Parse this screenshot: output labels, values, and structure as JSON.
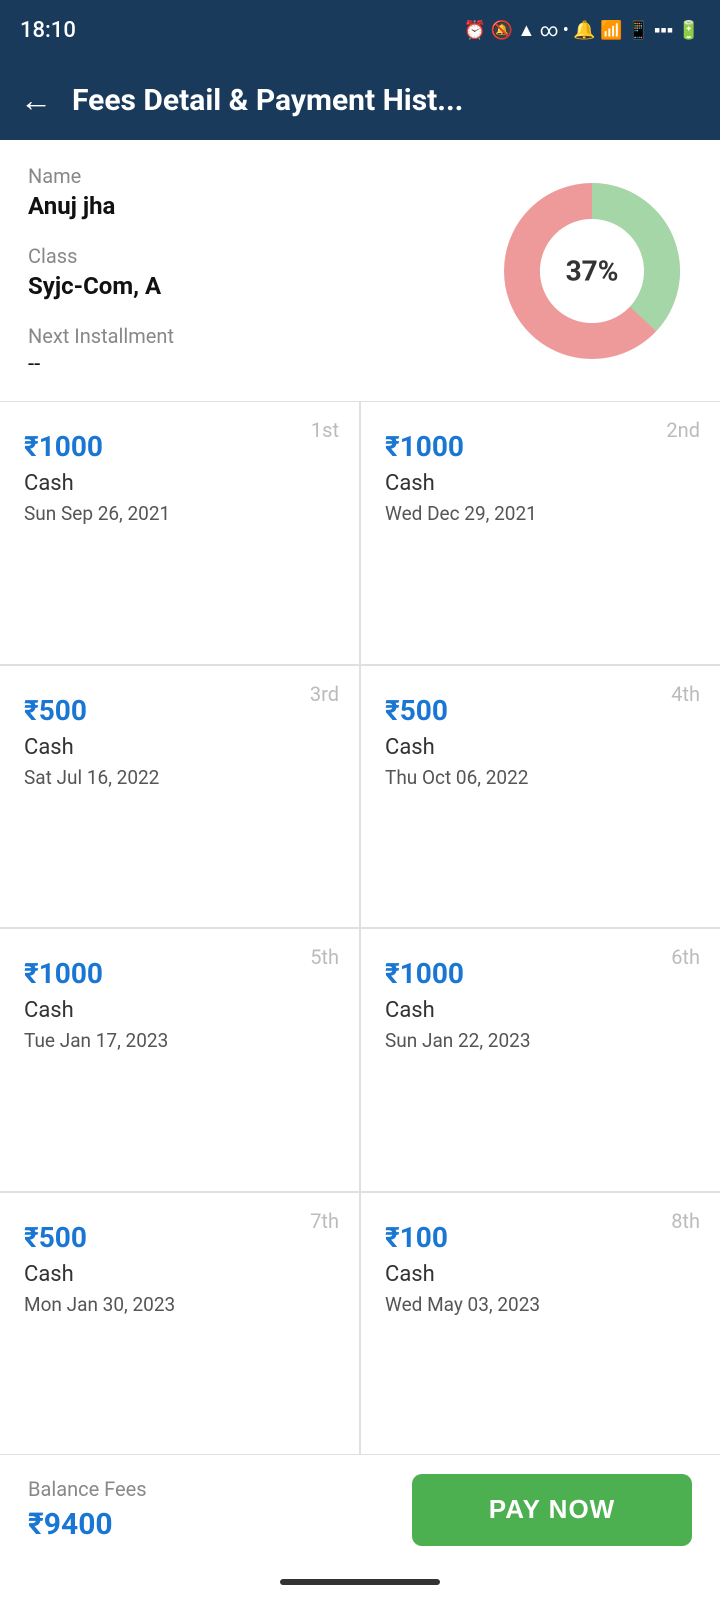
{
  "statusBar": {
    "time": "18:10",
    "icons": "⏰ 🔕 ▲ 📶 🔋"
  },
  "header": {
    "title": "Fees Detail & Payment Hist...",
    "backLabel": "←"
  },
  "profile": {
    "nameLabel": "Name",
    "nameValue": "Anuj jha",
    "classLabel": "Class",
    "classValue": "Syjc-Com, A",
    "installmentLabel": "Next Installment",
    "installmentValue": "--"
  },
  "chart": {
    "percentage": "37%",
    "paidColor": "#a5d6a7",
    "unpaidColor": "#ef9a9a"
  },
  "payments": [
    {
      "installment": "1st",
      "amount": "₹1000",
      "method": "Cash",
      "date": "Sun Sep 26, 2021"
    },
    {
      "installment": "2nd",
      "amount": "₹1000",
      "method": "Cash",
      "date": "Wed Dec 29, 2021"
    },
    {
      "installment": "3rd",
      "amount": "₹500",
      "method": "Cash",
      "date": "Sat Jul 16, 2022"
    },
    {
      "installment": "4th",
      "amount": "₹500",
      "method": "Cash",
      "date": "Thu Oct 06, 2022"
    },
    {
      "installment": "5th",
      "amount": "₹1000",
      "method": "Cash",
      "date": "Tue Jan 17, 2023"
    },
    {
      "installment": "6th",
      "amount": "₹1000",
      "method": "Cash",
      "date": "Sun Jan 22, 2023"
    },
    {
      "installment": "7th",
      "amount": "₹500",
      "method": "Cash",
      "date": "Mon Jan 30, 2023"
    },
    {
      "installment": "8th",
      "amount": "₹100",
      "method": "Cash",
      "date": "Wed May 03, 2023"
    }
  ],
  "bottomBar": {
    "balanceLabel": "Balance Fees",
    "balanceAmount": "₹9400",
    "payNowLabel": "PAY NOW"
  }
}
